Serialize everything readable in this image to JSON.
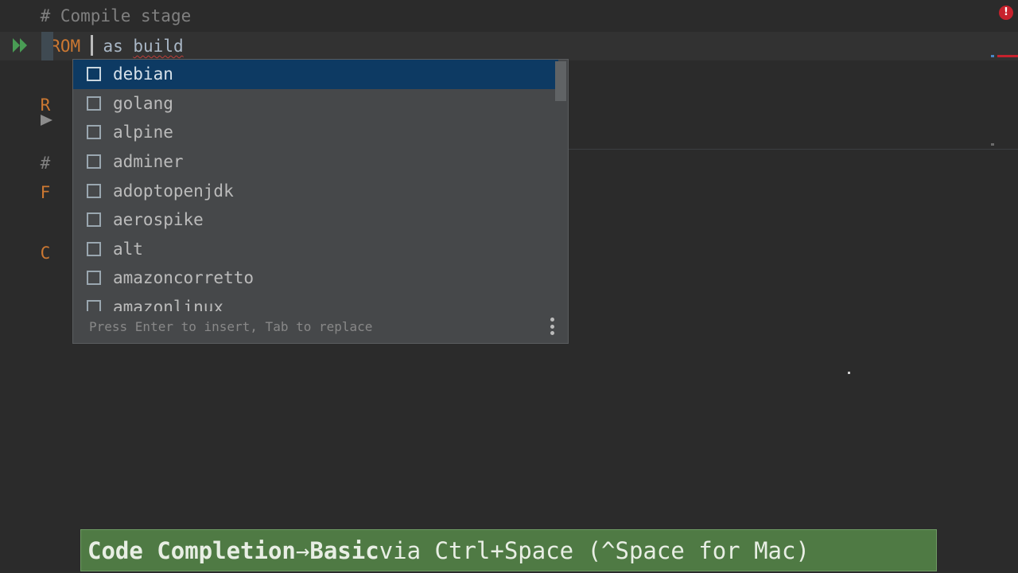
{
  "editor": {
    "line1_comment": "# Compile stage",
    "line2_keyword": "FROM",
    "line2_rest": " as build",
    "partial_lines": [
      "R",
      "#",
      "F",
      "C"
    ]
  },
  "completion": {
    "items": [
      {
        "label": "debian",
        "selected": true
      },
      {
        "label": "golang"
      },
      {
        "label": "alpine"
      },
      {
        "label": "adminer"
      },
      {
        "label": "adoptopenjdk"
      },
      {
        "label": "aerospike"
      },
      {
        "label": "alt"
      },
      {
        "label": "amazoncorretto"
      },
      {
        "label": "amazonlinux"
      }
    ],
    "footer": "Press Enter to insert, Tab to replace",
    "item_icon": "box-icon",
    "more_icon": "more-vertical-icon"
  },
  "caption": {
    "bold1": "Code Completion",
    "arrow": "→",
    "bold2": "Basic",
    "rest": "via Ctrl+Space (^Space for Mac)"
  },
  "colors": {
    "editor_bg": "#2b2b2b",
    "keyword": "#cc7832",
    "comment": "#808080",
    "selection": "#0d3a63",
    "run_icon": "#499c54",
    "caption_bg": "#4f7a44",
    "error": "#c7222d"
  }
}
